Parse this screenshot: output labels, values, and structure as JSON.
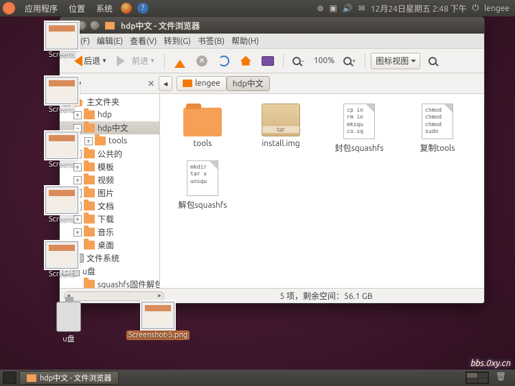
{
  "panel": {
    "menus": [
      "应用程序",
      "位置",
      "系统"
    ],
    "clock": "12月24日星期五 2:48 下午",
    "user": "lengee"
  },
  "desktop_icons": [
    {
      "label": "Screens",
      "type": "shot"
    },
    {
      "label": "Screens",
      "type": "shot"
    },
    {
      "label": "Screens",
      "type": "shot"
    },
    {
      "label": "Screens",
      "type": "shot"
    },
    {
      "label": "Screens",
      "type": "shot"
    },
    {
      "label": "u盘",
      "type": "usb"
    },
    {
      "label": "Screenshot-5.png",
      "type": "shot",
      "sel": true
    }
  ],
  "window": {
    "title": "hdp中文 - 文件浏览器",
    "menus": [
      "文件(F)",
      "编辑(E)",
      "查看(V)",
      "转到(G)",
      "书签(B)",
      "帮助(H)"
    ],
    "toolbar": {
      "back": "后退",
      "forward": "前进",
      "zoom": "100%",
      "view_mode": "图标视图"
    },
    "side_header": "树",
    "path": [
      {
        "label": "lengee",
        "icon": true
      },
      {
        "label": "hdp中文",
        "active": true
      }
    ],
    "tree": [
      {
        "d": 0,
        "exp": "-",
        "ic": "home",
        "label": "主文件夹"
      },
      {
        "d": 1,
        "exp": "+",
        "ic": "folder",
        "label": "hdp"
      },
      {
        "d": 1,
        "exp": "-",
        "ic": "folder",
        "label": "hdp中文",
        "sel": true
      },
      {
        "d": 2,
        "exp": "+",
        "ic": "folder",
        "label": "tools"
      },
      {
        "d": 1,
        "exp": "+",
        "ic": "folder",
        "label": "公共的"
      },
      {
        "d": 1,
        "exp": "+",
        "ic": "folder",
        "label": "模板"
      },
      {
        "d": 1,
        "exp": "+",
        "ic": "folder",
        "label": "视频"
      },
      {
        "d": 1,
        "exp": "+",
        "ic": "folder",
        "label": "图片"
      },
      {
        "d": 1,
        "exp": "+",
        "ic": "folder",
        "label": "文档"
      },
      {
        "d": 1,
        "exp": "+",
        "ic": "folder",
        "label": "下载"
      },
      {
        "d": 1,
        "exp": "+",
        "ic": "folder",
        "label": "音乐"
      },
      {
        "d": 1,
        "exp": "",
        "ic": "folder",
        "label": "桌面"
      },
      {
        "d": 0,
        "exp": "+",
        "ic": "fs",
        "label": "文件系统"
      },
      {
        "d": 0,
        "exp": "-",
        "ic": "usb",
        "label": "u盘"
      },
      {
        "d": 1,
        "exp": "",
        "ic": "folder",
        "label": "squashfs固件解包封包"
      }
    ],
    "files": [
      {
        "name": "tools",
        "type": "folder"
      },
      {
        "name": "install.img",
        "type": "tar"
      },
      {
        "name": "封包squashfs",
        "type": "script",
        "txt": "cp in\nrm in\nmksqu\nco.sq"
      },
      {
        "name": "复制tools",
        "type": "script",
        "txt": "chmod\nchmod\nchmod\nsudo"
      },
      {
        "name": "解包squashfs",
        "type": "script",
        "txt": "mkdir\ntar x\nunsqu"
      }
    ],
    "status": "5 项，剩余空间：56.1 GB"
  },
  "taskbar": {
    "task": "hdp中文 - 文件浏览器"
  },
  "watermark": "bbs.0xy.cn"
}
